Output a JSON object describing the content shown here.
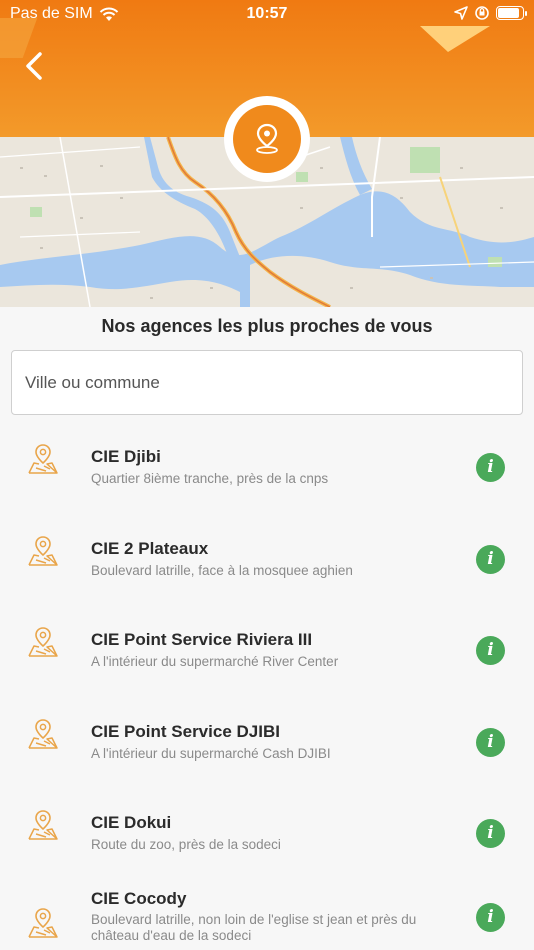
{
  "status_bar": {
    "carrier": "Pas de SIM",
    "time": "10:57"
  },
  "header": {
    "back_icon": "chevron-left-icon",
    "badge_icon": "location-pin-icon"
  },
  "colors": {
    "header_top": "#f07a12",
    "header_bottom": "#f39a2a",
    "accent_orange": "#f08a1c",
    "info_green": "#4aa95a",
    "icon_outline": "#e9a54a"
  },
  "title": "Nos agences les plus proches de vous",
  "search": {
    "placeholder": "Ville ou commune",
    "value": ""
  },
  "agencies": [
    {
      "name": "CIE Djibi",
      "address": "Quartier 8ième tranche, près de la cnps"
    },
    {
      "name": "CIE 2 Plateaux",
      "address": "Boulevard latrille, face à la mosquee aghien"
    },
    {
      "name": "CIE Point Service Riviera III",
      "address": "A l'intérieur du supermarché River Center"
    },
    {
      "name": "CIE Point Service DJIBI",
      "address": "A l'intérieur du supermarché Cash DJIBI"
    },
    {
      "name": "CIE Dokui",
      "address": "Route du zoo, près de la sodeci"
    },
    {
      "name": "CIE Cocody",
      "address": "Boulevard latrille, non loin de l'eglise st jean et près du château d'eau de la sodeci"
    }
  ]
}
